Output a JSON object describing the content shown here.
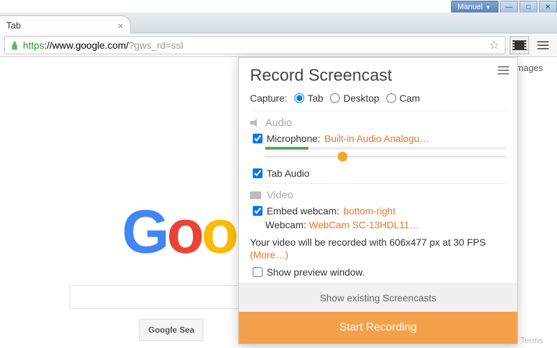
{
  "window": {
    "user": "Manuel"
  },
  "tab": {
    "title": "Tab"
  },
  "url": {
    "secure_part": "https",
    "rest": "://www.google.com/",
    "gray": "?gws_rd=ssl"
  },
  "page": {
    "images_link": "Images",
    "search_button": "Google Sea",
    "footer": "Privacy & Terms"
  },
  "popup": {
    "title": "Record Screencast",
    "capture_label": "Capture:",
    "capture_options": {
      "tab": "Tab",
      "desktop": "Desktop",
      "cam": "Cam"
    },
    "audio_section": "Audio",
    "microphone_label": "Microphone:",
    "microphone_value": "Built-in Audio Analogu…",
    "tab_audio": "Tab Audio",
    "video_section": "Video",
    "embed_label": "Embed webcam:",
    "embed_value": "bottom-right",
    "webcam_label": "Webcam:",
    "webcam_value": "WebCam SC-13HDL11…",
    "info_prefix": "Your video will be recorded with 606x477 px at 30 FPS ",
    "info_more": "(More…)",
    "preview_label": "Show preview window.",
    "show_existing": "Show existing Screencasts",
    "start": "Start Recording"
  }
}
